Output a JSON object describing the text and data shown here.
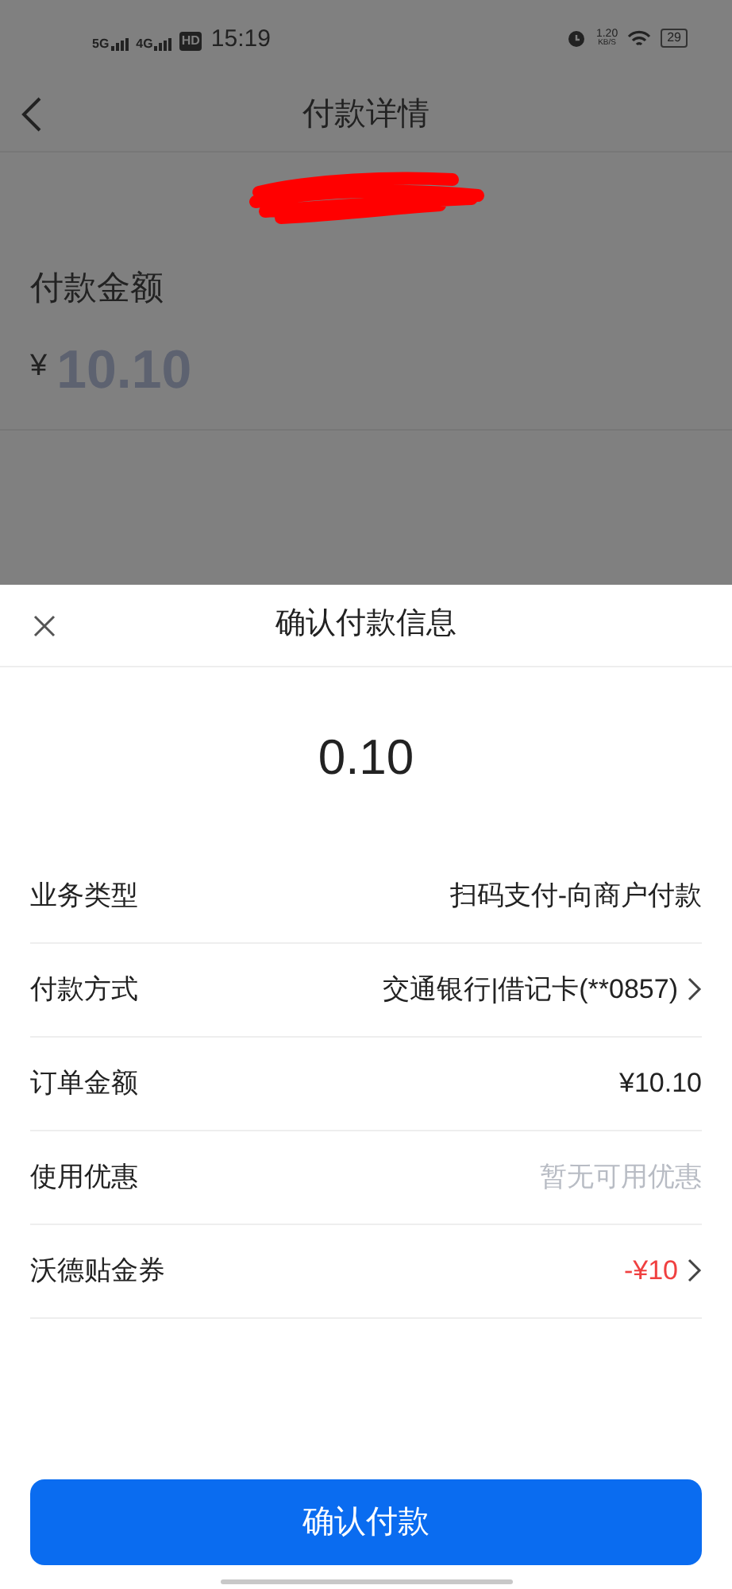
{
  "status_bar": {
    "time": "15:19",
    "network_labels": [
      "5G",
      "4G"
    ],
    "hd_label": "HD",
    "speed": "1.20",
    "speed_unit": "KB/S",
    "battery": "29"
  },
  "page": {
    "title": "付款详情",
    "amount_label": "付款金额",
    "currency": "¥",
    "amount": "10.10"
  },
  "sheet": {
    "title": "确认付款信息",
    "amount": "0.10",
    "rows": [
      {
        "label": "业务类型",
        "value": "扫码支付-向商户付款",
        "color": "#222222",
        "chevron": false
      },
      {
        "label": "付款方式",
        "value": "交通银行|借记卡(**0857)",
        "color": "#222222",
        "chevron": true
      },
      {
        "label": "订单金额",
        "value": "¥10.10",
        "color": "#222222",
        "chevron": false
      },
      {
        "label": "使用优惠",
        "value": "暂无可用优惠",
        "color": "#b8bcc4",
        "chevron": false
      },
      {
        "label": "沃德贴金券",
        "value": "-¥10",
        "color": "#f04040",
        "chevron": true
      }
    ],
    "confirm_button": "确认付款"
  }
}
